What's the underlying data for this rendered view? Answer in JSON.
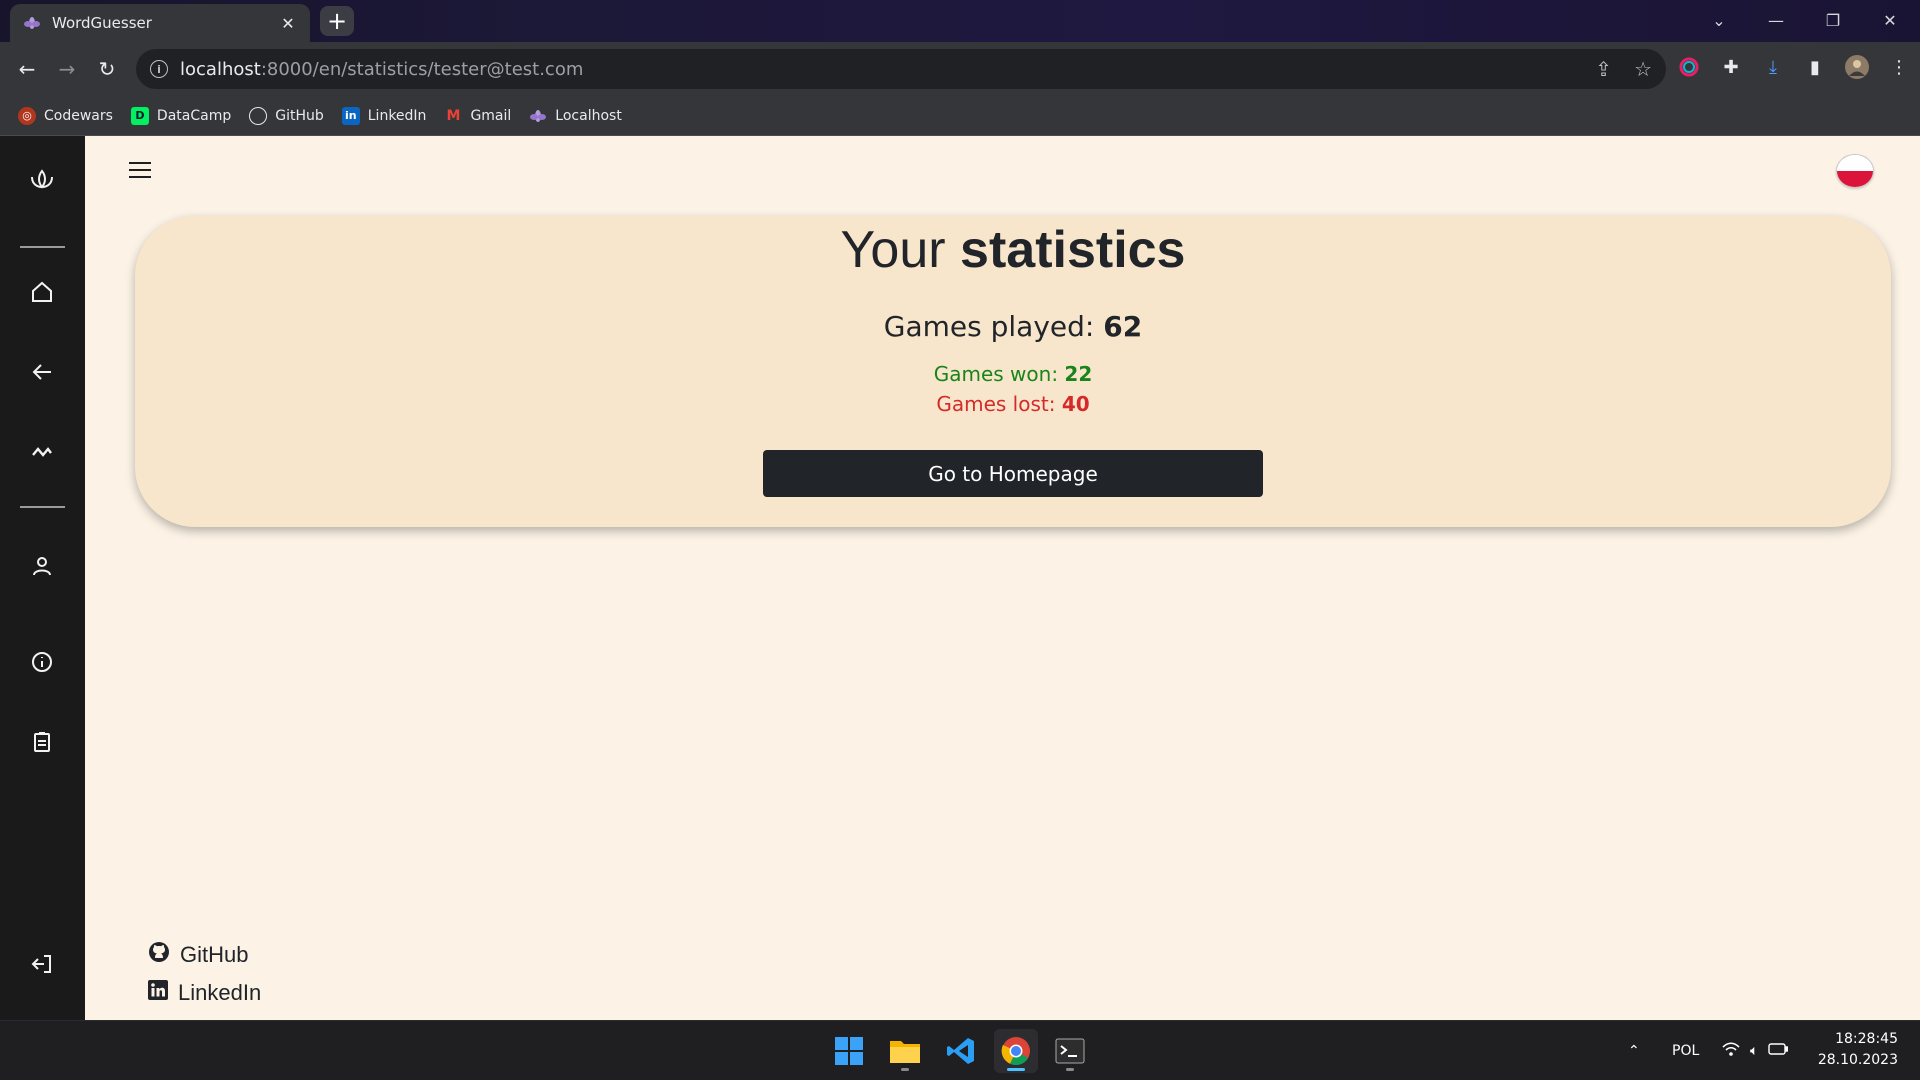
{
  "browser": {
    "tab_title": "WordGuesser",
    "tab_close": "✕",
    "new_tab": "+",
    "url_host": "localhost",
    "url_rest": ":8000/en/statistics/tester@test.com",
    "bookmarks": [
      {
        "label": "Codewars",
        "icon": "codewars-icon",
        "color": "#b1361e"
      },
      {
        "label": "DataCamp",
        "icon": "datacamp-icon",
        "color": "#03ef62"
      },
      {
        "label": "GitHub",
        "icon": "github-icon",
        "color": "#ffffff"
      },
      {
        "label": "LinkedIn",
        "icon": "linkedin-icon",
        "color": "#0a66c2"
      },
      {
        "label": "Gmail",
        "icon": "gmail-icon",
        "color": "#ea4335"
      },
      {
        "label": "Localhost",
        "icon": "lotus-icon",
        "color": "#b39ddb"
      }
    ]
  },
  "sidebar": {
    "items": [
      "logo-lotus-icon",
      "home-icon",
      "back-arrow-icon",
      "statistics-icon",
      "user-icon",
      "info-icon",
      "clipboard-icon",
      "logout-icon"
    ]
  },
  "page": {
    "title_light": "Your ",
    "title_bold": "statistics",
    "games_played_label": "Games played: ",
    "games_played_value": "62",
    "games_won_label": "Games won: ",
    "games_won_value": "22",
    "games_lost_label": "Games lost: ",
    "games_lost_value": "40",
    "home_button": "Go to Homepage",
    "language_flag": "poland-flag-icon"
  },
  "footer": {
    "github": "GitHub",
    "linkedin": "LinkedIn"
  },
  "taskbar": {
    "language": "POL",
    "time": "18:28:45",
    "date": "28.10.2023"
  },
  "colors": {
    "page_bg": "#fcf3e6",
    "card_bg": "#f8e6cc",
    "sidebar_bg": "#1a1a1a",
    "won": "#198419",
    "lost": "#d42a2a",
    "button_bg": "#212529"
  }
}
